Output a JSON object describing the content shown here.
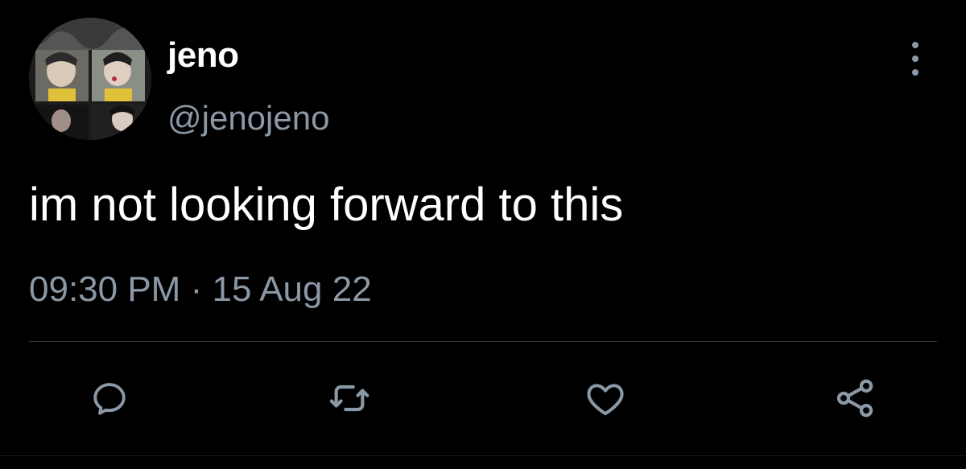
{
  "tweet": {
    "display_name": "jeno",
    "handle": "@jenojeno",
    "text": "im not looking forward to this",
    "time": "09:30 PM",
    "separator": "·",
    "date": "15 Aug 22"
  },
  "icons": {
    "avatar": "avatar-photo",
    "more": "more-vertical-icon",
    "reply": "reply-icon",
    "retweet": "retweet-icon",
    "like": "heart-icon",
    "share": "share-icon"
  },
  "colors": {
    "background": "#000000",
    "primary_text": "#ffffff",
    "secondary_text": "#8b98a5",
    "divider": "#2f3336"
  }
}
